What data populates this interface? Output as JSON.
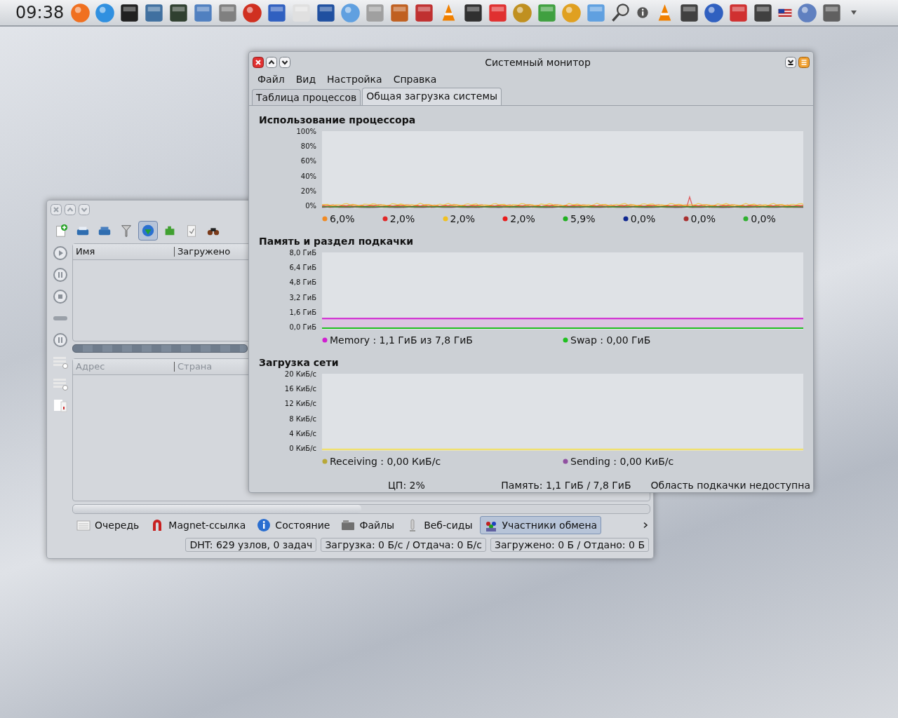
{
  "panel": {
    "clock": "09:38"
  },
  "system_monitor": {
    "title": "Системный монитор",
    "menu": [
      "Файл",
      "Вид",
      "Настройка",
      "Справка"
    ],
    "tabs": [
      {
        "label": "Таблица процессов",
        "selected": false
      },
      {
        "label": "Общая загрузка системы",
        "selected": true
      }
    ],
    "sections": [
      {
        "kind": "cpu",
        "title": "Использование процессора",
        "y_ticks": [
          "100%",
          "80%",
          "60%",
          "40%",
          "20%",
          "0%"
        ],
        "legend": [
          {
            "text": "6,0%",
            "color": "#f08a24"
          },
          {
            "text": "2,0%",
            "color": "#e02828"
          },
          {
            "text": "2,0%",
            "color": "#f0c020"
          },
          {
            "text": "2,0%",
            "color": "#e81c1c"
          },
          {
            "text": "5,9%",
            "color": "#20b020"
          },
          {
            "text": "0,0%",
            "color": "#102890"
          },
          {
            "text": "0,0%",
            "color": "#a83030"
          },
          {
            "text": "0,0%",
            "color": "#30b030"
          }
        ]
      },
      {
        "kind": "memory",
        "title": "Память и раздел подкачки",
        "y_ticks": [
          "8,0 ГиБ",
          "6,4 ГиБ",
          "4,8 ГиБ",
          "3,2 ГиБ",
          "1,6 ГиБ",
          "0,0 ГиБ"
        ],
        "legend": [
          {
            "text": "Memory : 1,1 ГиБ из 7,8 ГиБ",
            "color": "#d020d0"
          },
          {
            "text": "Swap : 0,00 ГиБ",
            "color": "#20c020"
          }
        ]
      },
      {
        "kind": "network",
        "title": "Загрузка сети",
        "y_ticks": [
          "20 КиБ/с",
          "16 КиБ/с",
          "12 КиБ/с",
          "8 КиБ/с",
          "4 КиБ/с",
          "0 КиБ/с"
        ],
        "legend": [
          {
            "text": "Receiving : 0,00 КиБ/с",
            "color": "#b8a838"
          },
          {
            "text": "Sending : 0,00 КиБ/с",
            "color": "#9050a0"
          }
        ]
      }
    ],
    "status": [
      "ЦП: 2%",
      "Память: 1,1 ГиБ / 7,8 ГиБ",
      "Область подкачки недоступна"
    ]
  },
  "torrent_client": {
    "toolbar": [
      {
        "selected": false
      },
      {
        "selected": false
      },
      {
        "selected": false
      },
      {
        "selected": false
      },
      {
        "selected": true
      },
      {
        "selected": false
      },
      {
        "selected": false
      },
      {
        "selected": false
      }
    ],
    "torrent_columns": [
      "Имя",
      "Загружено"
    ],
    "peer_columns": [
      "Адрес",
      "Страна"
    ],
    "tabs": [
      {
        "label": "Очередь",
        "selected": false
      },
      {
        "label": "Magnet-ссылка",
        "selected": false
      },
      {
        "label": "Состояние",
        "selected": false
      },
      {
        "label": "Файлы",
        "selected": false
      },
      {
        "label": "Веб-сиды",
        "selected": false
      },
      {
        "label": "Участники обмена",
        "selected": true
      }
    ],
    "status": [
      "DHT: 629 узлов, 0 задач",
      "Загрузка: 0 Б/с / Отдача: 0 Б/с",
      "Загружено: 0 Б / Отдано: 0 Б"
    ]
  }
}
